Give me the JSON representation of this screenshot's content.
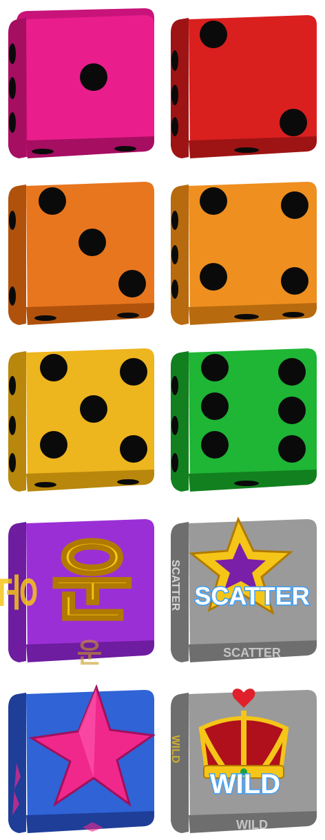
{
  "sheet": {
    "dice": [
      {
        "id": "die-1",
        "color": "#E91E8C",
        "pips": 1
      },
      {
        "id": "die-2",
        "color": "#D9201F",
        "pips": 2
      },
      {
        "id": "die-3",
        "color": "#E8761E",
        "pips": 3
      },
      {
        "id": "die-4",
        "color": "#EE8F1F",
        "pips": 4
      },
      {
        "id": "die-5",
        "color": "#EDB51E",
        "pips": 5
      },
      {
        "id": "die-6",
        "color": "#1FB535",
        "pips": 6
      },
      {
        "id": "die-luck",
        "color": "#9B2FD6",
        "symbol": "korean-luck",
        "label": "운"
      },
      {
        "id": "die-scatter",
        "color": "#9A9A9A",
        "symbol": "star-scatter",
        "label": "SCATTER"
      },
      {
        "id": "die-star",
        "color": "#2F63D6",
        "symbol": "pink-star"
      },
      {
        "id": "die-wild",
        "color": "#9A9A9A",
        "symbol": "crown-wild",
        "label": "WILD"
      }
    ],
    "colors": {
      "pip": "#0a0a0a",
      "gold": "#F5C518",
      "gold_dark": "#B07A00",
      "scatter_text_glow": "#3AA0FF",
      "star_pink": "#F0288C",
      "crown_red": "#B0101C",
      "heart_red": "#E0202A"
    }
  }
}
